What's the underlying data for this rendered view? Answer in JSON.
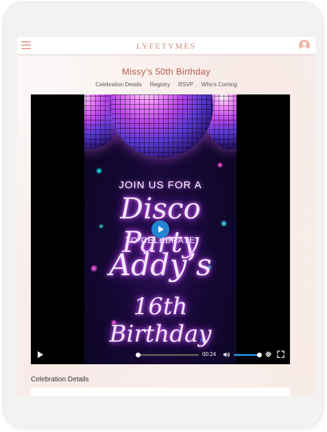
{
  "app": {
    "brand": "LYFETYMES"
  },
  "event": {
    "title": "Missy’s 50th Birthday"
  },
  "nav": [
    {
      "label": "Celebration Details"
    },
    {
      "label": "Registry"
    },
    {
      "label": "RSVP"
    },
    {
      "label": "Who’s Coming"
    }
  ],
  "video": {
    "poster_lines": [
      "JOIN US FOR A",
      "Disco Party",
      "TO CELEBRATE",
      "Addy’s",
      "16th Birthday"
    ],
    "time": "00:24",
    "progress_fraction": 0,
    "volume_fraction": 1.0,
    "accent_color": "#2185d0"
  },
  "sections": {
    "details_label": "Celebration Details"
  },
  "icons": [
    "menu-icon",
    "profile-icon",
    "play-icon",
    "volume-icon",
    "gear-icon",
    "fullscreen-icon"
  ],
  "colors": {
    "brand": "#c98f80",
    "title": "#b55a4b",
    "menu": "#e8a897"
  }
}
